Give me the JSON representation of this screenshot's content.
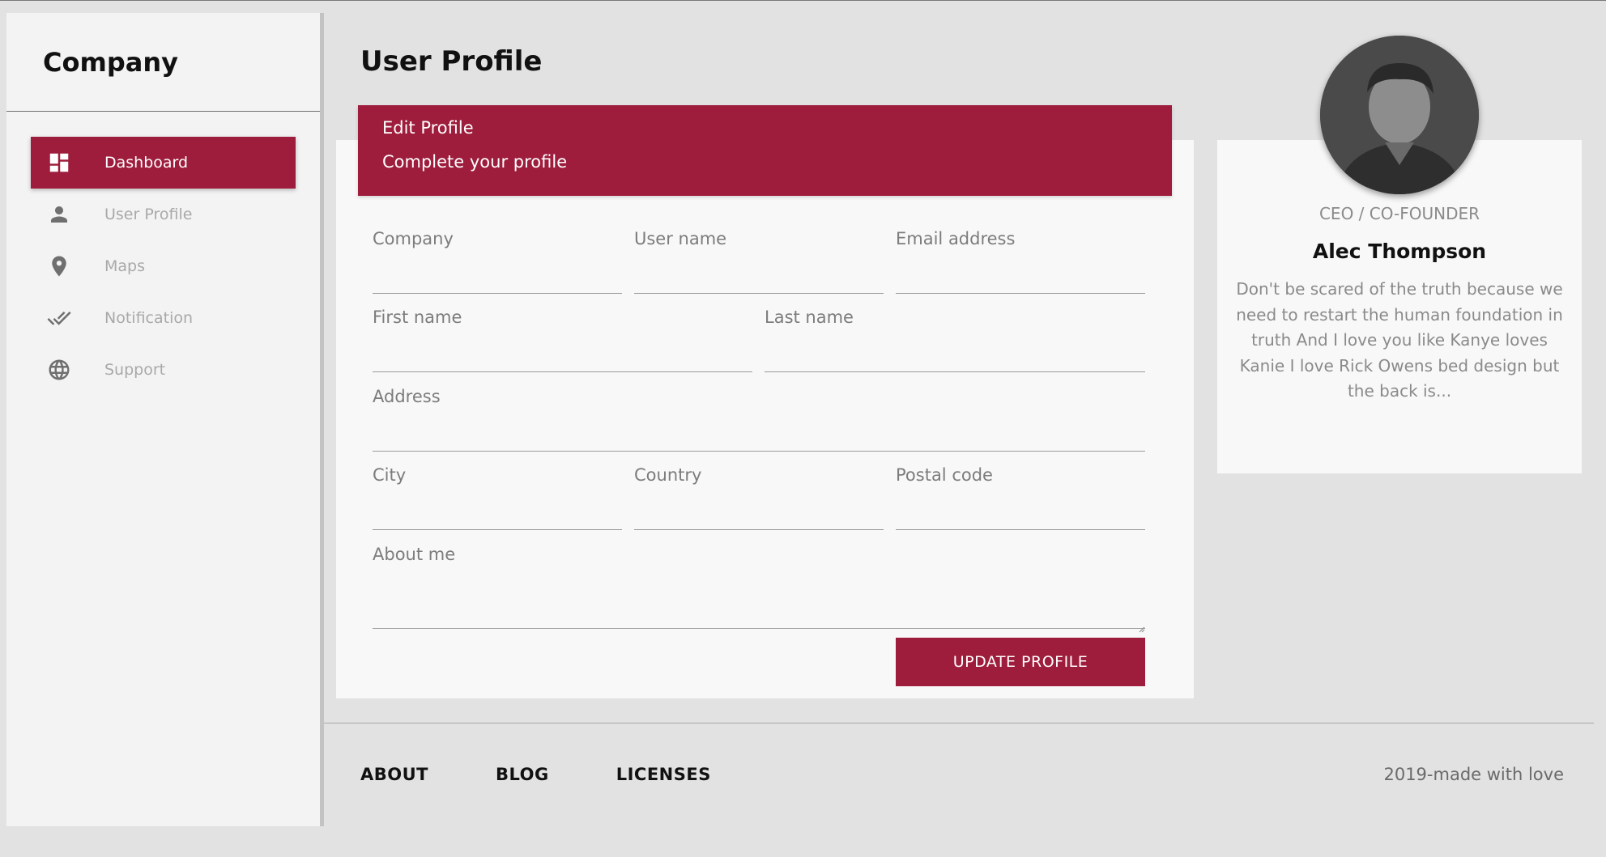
{
  "sidebar": {
    "brand": "Company",
    "items": [
      {
        "label": "Dashboard",
        "icon": "dashboard-icon",
        "active": true
      },
      {
        "label": "User Profile",
        "icon": "person-icon",
        "active": false
      },
      {
        "label": "Maps",
        "icon": "location-pin-icon",
        "active": false
      },
      {
        "label": "Notification",
        "icon": "double-check-icon",
        "active": false
      },
      {
        "label": "Support",
        "icon": "globe-icon",
        "active": false
      }
    ]
  },
  "header": {
    "title": "User Profile"
  },
  "form": {
    "title": "Edit Profile",
    "subtitle": "Complete your profile",
    "fields": {
      "company": {
        "label": "Company",
        "value": ""
      },
      "username": {
        "label": "User name",
        "value": ""
      },
      "email": {
        "label": "Email address",
        "value": ""
      },
      "first_name": {
        "label": "First name",
        "value": ""
      },
      "last_name": {
        "label": "Last name",
        "value": ""
      },
      "address": {
        "label": "Address",
        "value": ""
      },
      "city": {
        "label": "City",
        "value": ""
      },
      "country": {
        "label": "Country",
        "value": ""
      },
      "postal_code": {
        "label": "Postal code",
        "value": ""
      },
      "about": {
        "label": "About me",
        "value": ""
      }
    },
    "submit_label": "UPDATE PROFILE"
  },
  "profile": {
    "role": "CEO / CO-FOUNDER",
    "name": "Alec Thompson",
    "bio": "Don't be scared of the truth because we need to restart the human foundation in truth And I love you like Kanye loves Kanie I love Rick Owens bed design but the back is..."
  },
  "footer": {
    "links": [
      "ABOUT",
      "BLOG",
      "LICENSES"
    ],
    "copyright": "2019-made with love"
  },
  "colors": {
    "accent": "#9e1d3c",
    "background": "#e2e2e2",
    "card": "#f8f8f8",
    "sidebar": "#f3f3f3"
  }
}
